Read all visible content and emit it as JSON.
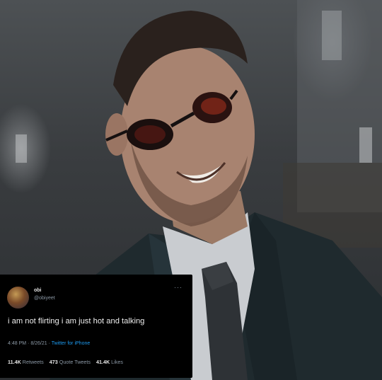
{
  "tweet": {
    "display_name": "obi",
    "handle": "@obiyeet",
    "more_label": "···",
    "text": "i am not flirting i am just hot and talking",
    "time": "4:48 PM",
    "date": "8/26/21",
    "separator": " · ",
    "source": "Twitter for iPhone",
    "retweets_count": "11.4K",
    "retweets_label": "Retweets",
    "quotes_count": "473",
    "quotes_label": "Quote Tweets",
    "likes_count": "41.4K",
    "likes_label": "Likes"
  },
  "colors": {
    "tweet_background": "#000000",
    "secondary_text": "#8b98a5",
    "link_blue": "#1d9bf0"
  }
}
